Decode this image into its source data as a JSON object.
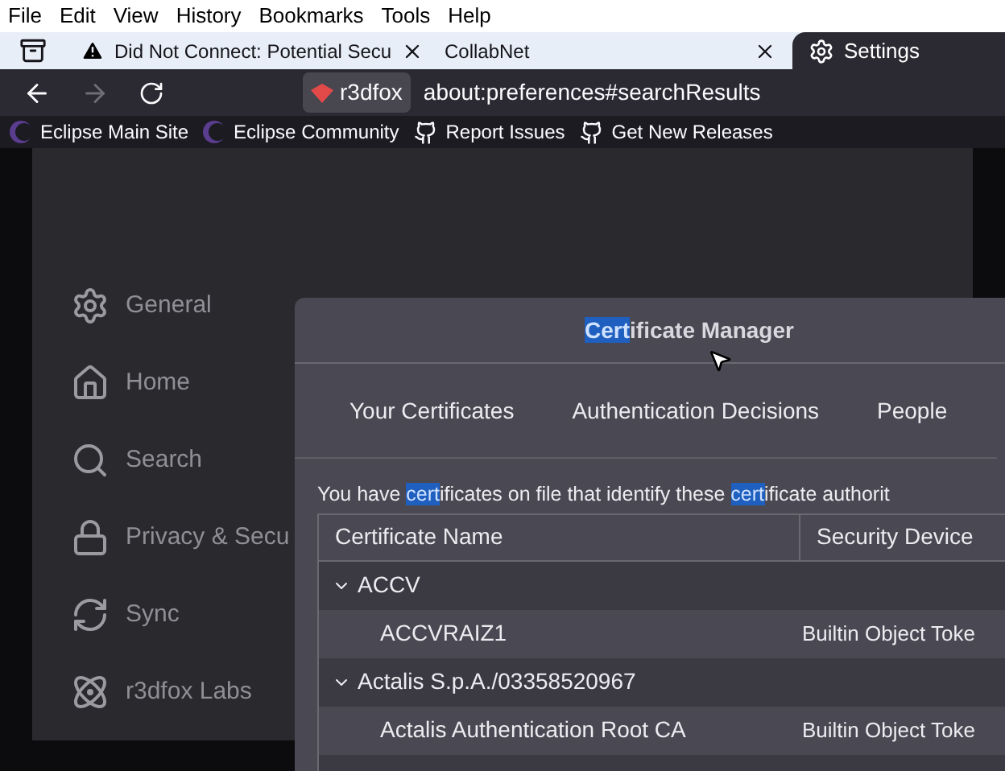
{
  "menu_bar": [
    "File",
    "Edit",
    "View",
    "History",
    "Bookmarks",
    "Tools",
    "Help"
  ],
  "tabs": [
    {
      "label": "Did Not Connect: Potential Secu",
      "kind": "warning",
      "selected": false
    },
    {
      "label": "CollabNet",
      "kind": "plain",
      "selected": false
    },
    {
      "label": "Settings",
      "kind": "settings",
      "selected": true
    }
  ],
  "address_bar": {
    "identity": "r3dfox",
    "url": "about:preferences#searchResults"
  },
  "bookmarks": [
    {
      "label": "Eclipse Main Site",
      "kind": "eclipse"
    },
    {
      "label": "Eclipse Community",
      "kind": "eclipse"
    },
    {
      "label": "Report Issues",
      "kind": "github"
    },
    {
      "label": "Get New Releases",
      "kind": "github"
    }
  ],
  "sidebar": {
    "items": [
      {
        "label": "General",
        "kind": "general"
      },
      {
        "label": "Home",
        "kind": "home"
      },
      {
        "label": "Search",
        "kind": "search"
      },
      {
        "label": "Privacy & Secu",
        "kind": "privacy"
      },
      {
        "label": "Sync",
        "kind": "sync"
      },
      {
        "label": "r3dfox Labs",
        "kind": "labs"
      }
    ]
  },
  "dialog": {
    "title": [
      {
        "text": "Cert",
        "highlighted": true
      },
      {
        "text": "ificate Manager",
        "highlighted": false
      }
    ],
    "tabs": [
      {
        "label": "Your Certificates"
      },
      {
        "label": "Authentication Decisions"
      },
      {
        "label": "People"
      }
    ],
    "description": [
      {
        "text": "You have ",
        "highlighted": false
      },
      {
        "text": "cert",
        "highlighted": true
      },
      {
        "text": "ificates on file that identify these ",
        "highlighted": false
      },
      {
        "text": "cert",
        "highlighted": true
      },
      {
        "text": "ificate authorit",
        "highlighted": false
      }
    ],
    "table": {
      "columns": [
        "Certificate Name",
        "Security Device"
      ],
      "rows": [
        {
          "name": "ACCV",
          "expanded": true,
          "children": [
            {
              "name": "ACCVRAIZ1",
              "device": "Builtin Object Toke"
            }
          ]
        },
        {
          "name": "Actalis S.p.A./03358520967",
          "expanded": true,
          "children": [
            {
              "name": "Actalis Authentication Root CA",
              "device": "Builtin Object Toke"
            }
          ]
        }
      ]
    }
  }
}
